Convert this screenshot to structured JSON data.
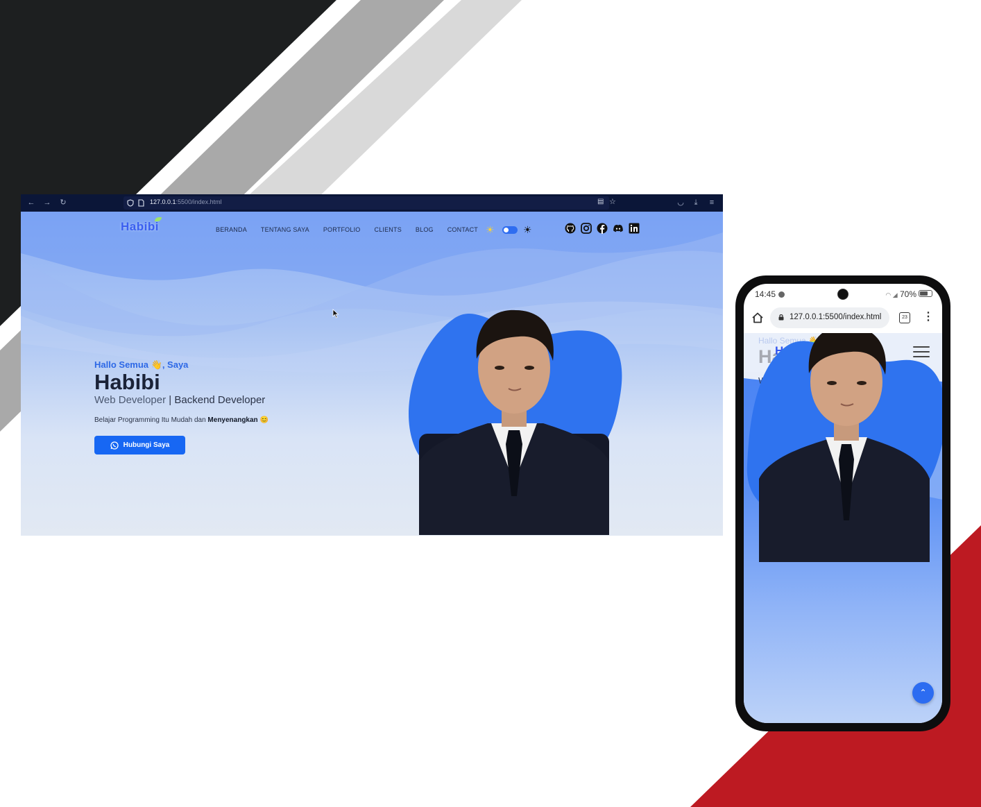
{
  "browser": {
    "url_host": "127.0.0.1",
    "url_rest": ":5500/index.html"
  },
  "site": {
    "logo": "Habibi",
    "nav": [
      "BERANDA",
      "TENTANG SAYA",
      "PORTFOLIO",
      "CLIENTS",
      "BLOG",
      "CONTACT"
    ],
    "socials": [
      "github-icon",
      "instagram-icon",
      "facebook-icon",
      "discord-icon",
      "linkedin-icon"
    ],
    "greeting": "Hallo Semua 👋, Saya",
    "name": "Habibi",
    "role_first": "Web Developer",
    "role_sep": "|",
    "role_second": "Backend Developer",
    "desc_prefix": "Belajar Programming Itu Mudah dan",
    "desc_bold": "Menyenangkan",
    "desc_emoji": "😊",
    "cta_label": "Hubungi Saya"
  },
  "phone": {
    "time": "14:45",
    "battery": "70%",
    "url": "127.0.0.1:5500/index.html",
    "tab_count": "23"
  },
  "colors": {
    "accent": "#1767f3",
    "dark_stripe": "#1d1f20",
    "red_corner": "#bd1a22",
    "browser_chrome": "#0b1638"
  }
}
